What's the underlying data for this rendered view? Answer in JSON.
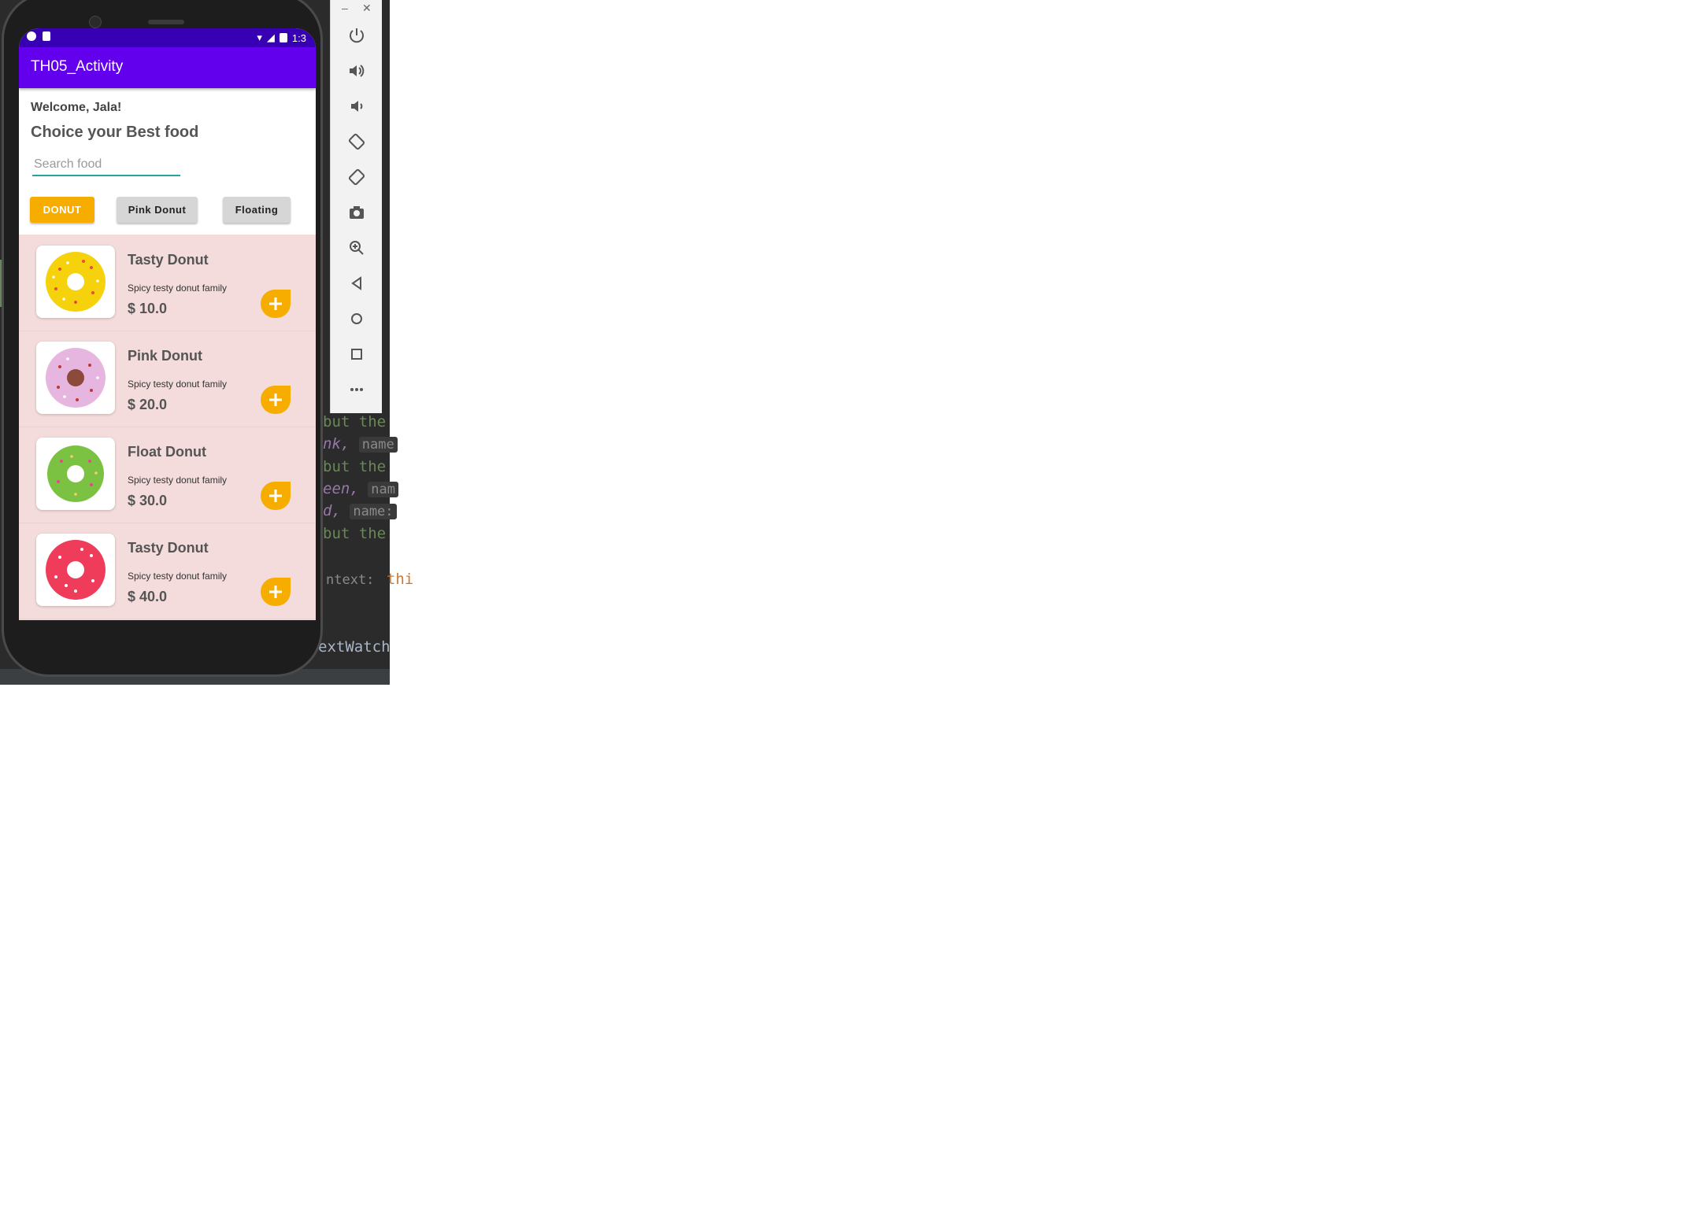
{
  "app": {
    "title": "TH05_Activity",
    "status_time": "1:3"
  },
  "header": {
    "welcome": "Welcome, Jala!",
    "heading": "Choice your Best food"
  },
  "search": {
    "placeholder": "Search food",
    "value": ""
  },
  "filters": [
    {
      "label": "Donut",
      "active": true
    },
    {
      "label": "Pink Donut",
      "active": false
    },
    {
      "label": "Floating",
      "active": false
    }
  ],
  "items": [
    {
      "name": "Tasty Donut",
      "description": "Spicy testy donut family",
      "price": "$ 10.0",
      "color": "#f5d20b"
    },
    {
      "name": "Pink Donut",
      "description": "Spicy testy donut family",
      "price": "$ 20.0",
      "color": "#e7b6e0"
    },
    {
      "name": "Float Donut",
      "description": "Spicy testy donut family",
      "price": "$ 30.0",
      "color": "#7cc242"
    },
    {
      "name": "Tasty Donut",
      "description": "Spicy testy donut family",
      "price": "$ 40.0",
      "color": "#ee3c5a"
    }
  ],
  "ide_code": {
    "line1": "but the",
    "line2": "nk,",
    "hint2": "name",
    "line3": "but the",
    "line4": "een,",
    "hint4": "nam",
    "line5": "d,",
    "hint5": "name:",
    "line6": "but the",
    "hint7": "ntext:",
    "line7": "thi",
    "line8": "extWatch"
  },
  "colors": {
    "primary": "#6200ee",
    "primary_dark": "#3700b3",
    "accent": "#f6ad00",
    "list_bg": "#f3dcdb",
    "search_underline": "#26a69a"
  }
}
